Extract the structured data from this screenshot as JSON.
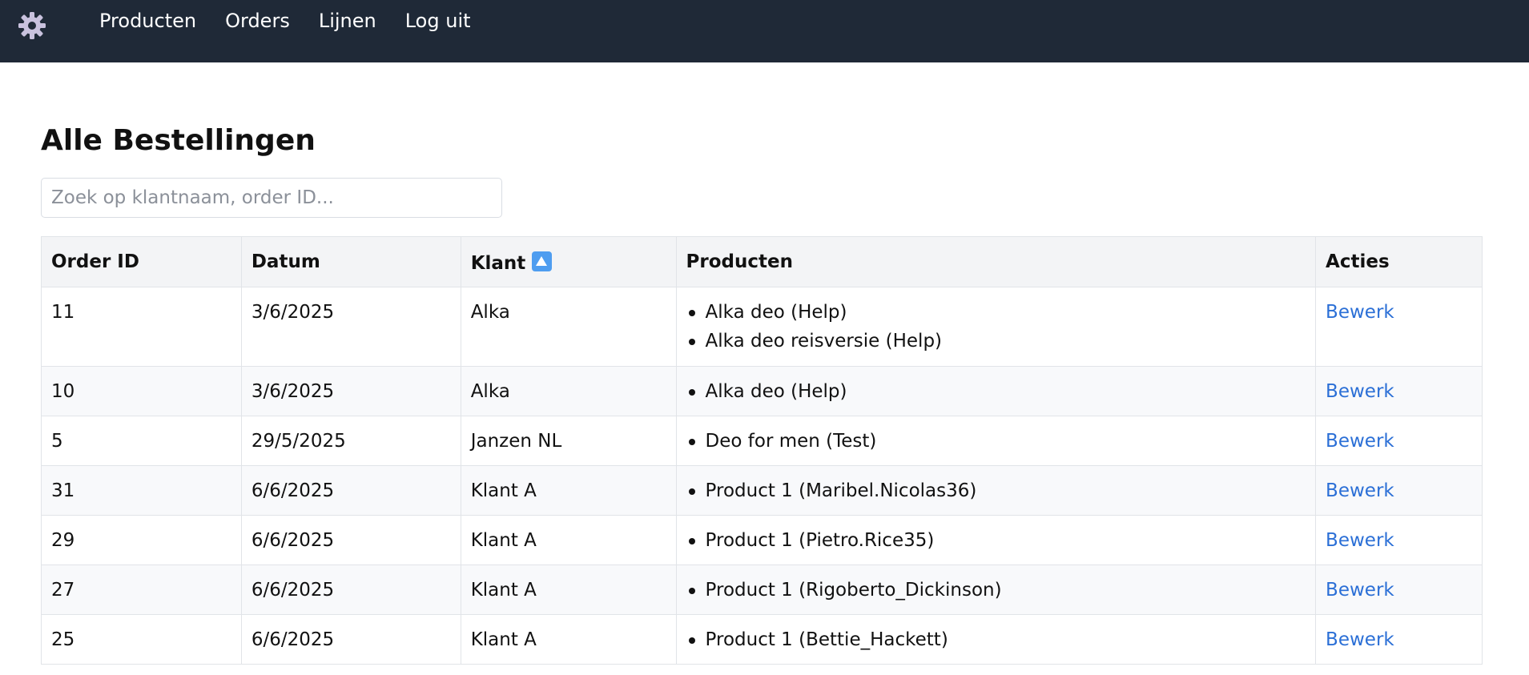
{
  "theme": {
    "navbar_bg": "#1f2937",
    "link_color": "#2b6fd6",
    "sort_icon_color": "#4e9df0"
  },
  "nav": {
    "logo_icon": "gear-icon",
    "links": [
      "Producten",
      "Orders",
      "Lijnen",
      "Log uit"
    ]
  },
  "page": {
    "title": "Alle Bestellingen"
  },
  "search": {
    "placeholder": "Zoek op klantnaam, order ID...",
    "value": ""
  },
  "table": {
    "headers": {
      "order_id": "Order ID",
      "datum": "Datum",
      "klant": "Klant",
      "producten": "Producten",
      "acties": "Acties"
    },
    "sort_icon": "arrow-up-icon",
    "rows": [
      {
        "order_id": "11",
        "datum": "3/6/2025",
        "klant": "Alka",
        "producten": [
          "Alka deo (Help)",
          "Alka deo reisversie (Help)"
        ],
        "actie": "Bewerk"
      },
      {
        "order_id": "10",
        "datum": "3/6/2025",
        "klant": "Alka",
        "producten": [
          "Alka deo (Help)"
        ],
        "actie": "Bewerk"
      },
      {
        "order_id": "5",
        "datum": "29/5/2025",
        "klant": "Janzen NL",
        "producten": [
          "Deo for men (Test)"
        ],
        "actie": "Bewerk"
      },
      {
        "order_id": "31",
        "datum": "6/6/2025",
        "klant": "Klant A",
        "producten": [
          "Product 1 (Maribel.Nicolas36)"
        ],
        "actie": "Bewerk"
      },
      {
        "order_id": "29",
        "datum": "6/6/2025",
        "klant": "Klant A",
        "producten": [
          "Product 1 (Pietro.Rice35)"
        ],
        "actie": "Bewerk"
      },
      {
        "order_id": "27",
        "datum": "6/6/2025",
        "klant": "Klant A",
        "producten": [
          "Product 1 (Rigoberto_Dickinson)"
        ],
        "actie": "Bewerk"
      },
      {
        "order_id": "25",
        "datum": "6/6/2025",
        "klant": "Klant A",
        "producten": [
          "Product 1 (Bettie_Hackett)"
        ],
        "actie": "Bewerk"
      }
    ]
  }
}
